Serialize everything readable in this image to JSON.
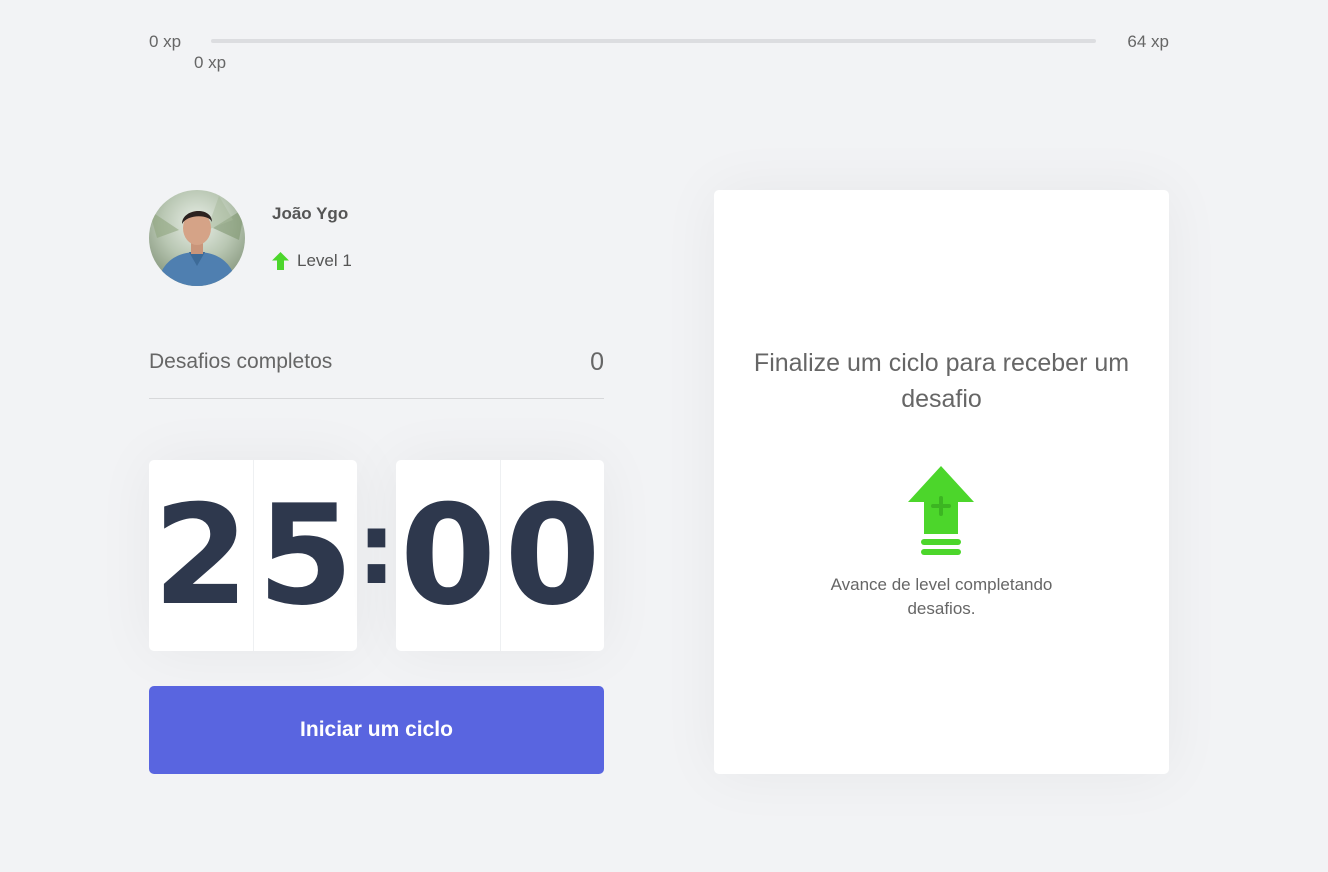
{
  "experience": {
    "min_label": "0 xp",
    "max_label": "64 xp",
    "current_label": "0 xp",
    "progress_fraction": 0,
    "fill_color": "#4cd62b"
  },
  "profile": {
    "name": "João Ygo",
    "level_label": "Level 1",
    "level_icon": "level-up-arrow-icon",
    "avatar": "user-avatar-photo"
  },
  "completed_challenges": {
    "label": "Desafios completos",
    "count": "0"
  },
  "countdown": {
    "minute_left": "2",
    "minute_right": "5",
    "separator": ":",
    "second_left": "0",
    "second_right": "0"
  },
  "start_button": {
    "label": "Iniciar um ciclo",
    "color": "#5965e0"
  },
  "challenge_box": {
    "title": "Finalize um ciclo para receber um desafio",
    "icon": "level-up-icon",
    "description": "Avance de level completando desafios."
  }
}
